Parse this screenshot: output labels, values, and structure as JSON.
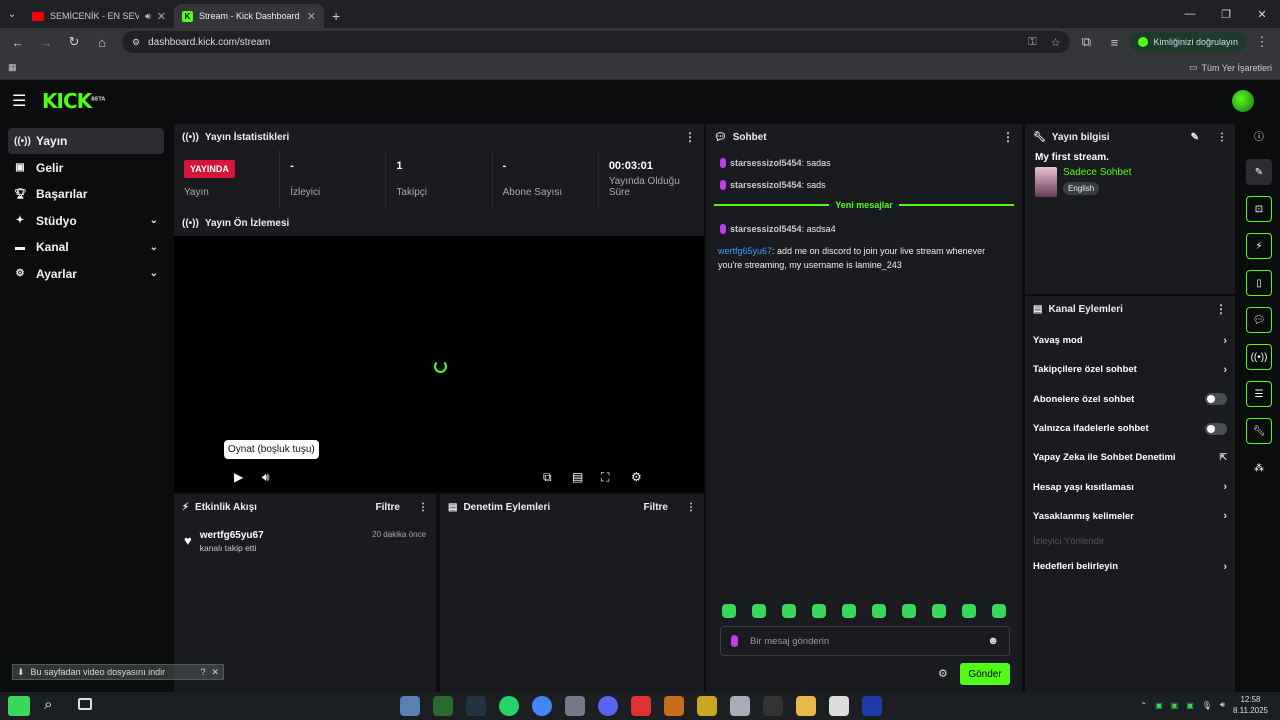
{
  "browser": {
    "tabs": [
      {
        "title": "SEMİCENİK - EN SEVİLEN Ş",
        "active": false
      },
      {
        "title": "Stream - Kick Dashboard",
        "active": true
      }
    ],
    "url": "dashboard.kick.com/stream",
    "profile_label": "Kimliğinizi doğrulayın",
    "bookmarks_label": "Tüm Yer İşaretleri"
  },
  "app": {
    "logo": "KICK",
    "logo_badge": "BETA",
    "sidebar": [
      {
        "label": "Yayın",
        "icon": "broadcast-icon",
        "expandable": false,
        "active": true
      },
      {
        "label": "Gelir",
        "icon": "revenue-icon",
        "expandable": false
      },
      {
        "label": "Başarılar",
        "icon": "trophy-icon",
        "expandable": false
      },
      {
        "label": "Stüdyo",
        "icon": "studio-icon",
        "expandable": true
      },
      {
        "label": "Kanal",
        "icon": "channel-icon",
        "expandable": true
      },
      {
        "label": "Ayarlar",
        "icon": "settings-icon",
        "expandable": true
      }
    ]
  },
  "stats": {
    "title": "Yayın İstatistikleri",
    "items": [
      {
        "value": "YAYINDA",
        "label": "Yayın"
      },
      {
        "value": "-",
        "label": "İzleyici"
      },
      {
        "value": "1",
        "label": "Takipçi"
      },
      {
        "value": "-",
        "label": "Abone Sayısı"
      },
      {
        "value": "00:03:01",
        "label": "Yayında Olduğu Süre"
      }
    ]
  },
  "preview": {
    "title": "Yayın Ön İzlemesi",
    "tooltip": "Oynat (boşluk tuşu)"
  },
  "activity": {
    "title": "Etkinlik Akışı",
    "filter": "Filtre",
    "items": [
      {
        "user": "wertfg65yu67",
        "text": "kanalı takip etti",
        "time": "20 dakika önce"
      }
    ]
  },
  "moderation": {
    "title": "Denetim Eylemleri",
    "filter": "Filtre"
  },
  "chat": {
    "title": "Sohbet",
    "messages_before": [
      {
        "user": "starsessizol5454",
        "text": ": sadas"
      },
      {
        "user": "starsessizol5454",
        "text": ": sads"
      }
    ],
    "new_messages_label": "Yeni mesajlar",
    "messages_after": [
      {
        "user": "starsessizol5454",
        "text": ": asdsa4",
        "mic": true
      },
      {
        "user": "wertfg65yu67",
        "text": ": add me on discord to join your live stream whenever you're streaming, my username is lamine_243",
        "mic": false
      }
    ],
    "input_placeholder": "Bir mesaj gönderin",
    "send_label": "Gönder"
  },
  "stream_info": {
    "title": "Yayın bilgisi",
    "stream_title": "My first stream.",
    "category": "Sadece Sohbet",
    "language": "English"
  },
  "channel_actions": {
    "title": "Kanal Eylemleri",
    "items": [
      {
        "label": "Yavaş mod",
        "control": "chevron"
      },
      {
        "label": "Takipçilere özel sohbet",
        "control": "chevron"
      },
      {
        "label": "Abonelere özel sohbet",
        "control": "toggle"
      },
      {
        "label": "Yalnızca ifadelerle sohbet",
        "control": "toggle"
      },
      {
        "label": "Yapay Zeka ile Sohbet Denetimi",
        "control": "external"
      },
      {
        "label": "Hesap yaşı kısıtlaması",
        "control": "chevron"
      },
      {
        "label": "Yasaklanmış kelimeler",
        "control": "chevron"
      },
      {
        "label": "İzleyici Yönlendir",
        "control": "none",
        "disabled": true
      },
      {
        "label": "Hedefleri belirleyin",
        "control": "chevron"
      }
    ]
  },
  "download_notice": "Bu sayfadan video dosyasını indir",
  "taskbar": {
    "time": "12:58",
    "date": "8.11.2025"
  },
  "colors": {
    "brand": "#53fc18",
    "live": "#d7153a",
    "panel": "#191b1f"
  }
}
